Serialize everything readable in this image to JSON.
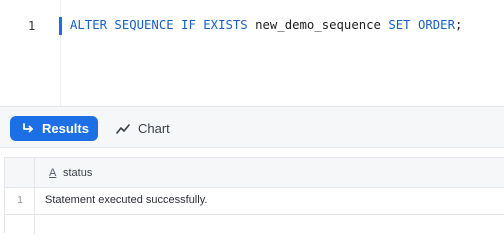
{
  "editor": {
    "line_number": "1",
    "tokens": {
      "kw1": "ALTER SEQUENCE IF EXISTS",
      "ident": "new_demo_sequence",
      "kw2": "SET ORDER",
      "end": ";"
    }
  },
  "toolbar": {
    "results_label": "Results",
    "chart_label": "Chart"
  },
  "grid": {
    "column_type_icon": "A",
    "columns": [
      "status"
    ],
    "rows": [
      {
        "index": "1",
        "status": "Statement executed successfully."
      }
    ]
  },
  "colors": {
    "accent": "#1d6fe6",
    "keyword": "#1a5fc4"
  },
  "icons": {
    "results": "return-arrow-icon",
    "chart": "line-chart-icon"
  }
}
